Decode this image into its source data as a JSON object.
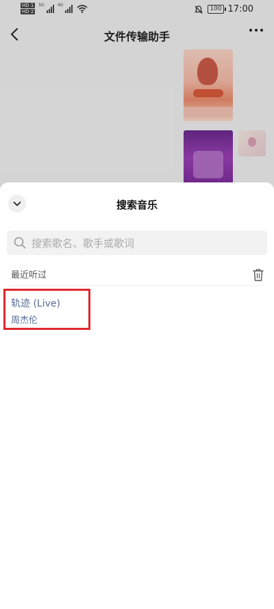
{
  "status_bar": {
    "sim1": "HD 1",
    "sim2": "HD 2",
    "net1": "5G",
    "net2": "4G",
    "battery": "100",
    "time": "17:00",
    "icons": [
      "signal-icon",
      "wifi-icon",
      "mute-icon",
      "battery-icon"
    ]
  },
  "header": {
    "title": "文件传输助手",
    "back_icon": "chevron-left-icon",
    "more_icon": "more-icon"
  },
  "sheet": {
    "title": "搜索音乐",
    "collapse_icon": "chevron-down-icon",
    "search": {
      "placeholder": "搜索歌名、歌手或歌词",
      "value": ""
    },
    "recent": {
      "label": "最近听过",
      "clear_icon": "trash-icon",
      "items": [
        {
          "title": "轨迹 (Live)",
          "artist": "周杰伦"
        }
      ]
    }
  },
  "colors": {
    "accent_link": "#576b95",
    "highlight": "#e0272d",
    "background": "#ededed"
  }
}
